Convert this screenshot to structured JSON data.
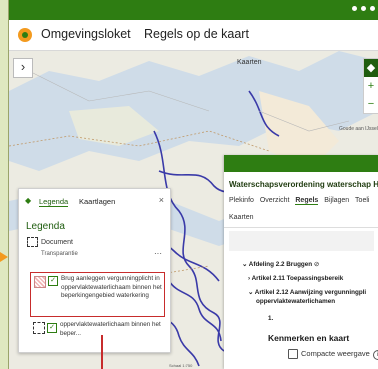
{
  "app": {
    "brand": "Omgevingsloket",
    "nav_link": "Regels op de kaart"
  },
  "map": {
    "labels": {
      "kaarten": "Kaarten",
      "goude": "Goude aan IJssel"
    },
    "scale": "Schaal 1:750",
    "colors": {
      "water": "#cfdce8",
      "land": "#f1efe6",
      "route": "#3a3aa8",
      "accent": "#2e7d12"
    }
  },
  "legend": {
    "tabs": [
      "Legenda",
      "Kaartlagen"
    ],
    "active_tab": "Legenda",
    "title": "Legenda",
    "document_label": "Document",
    "transparency_label": "Transparantie",
    "more": "···",
    "items": [
      {
        "text": "Brug aanleggen vergunningplicht in oppervlaktewaterlichaam binnen het beperkingengebied waterkering",
        "checked": true,
        "highlighted": true
      },
      {
        "text": "oppervlaktewaterlichaam binnen het beper...",
        "checked": true,
        "highlighted": false
      }
    ]
  },
  "panel": {
    "title": "Waterschapsverordening waterschap H",
    "tabs": [
      "Plekinfo",
      "Overzicht",
      "Regels",
      "Bijlagen",
      "Toeli"
    ],
    "active_tab": "Regels",
    "subtab": "Kaarten",
    "tree": [
      "Afdeling 2.2 Bruggen",
      "Artikel 2.11 Toepassingsbereik",
      "Artikel 2.12 Aanwijzing vergunningpli",
      "oppervlaktewaterlichamen",
      "1."
    ],
    "kenmerken_title": "Kenmerken en kaart",
    "compact_label": "Compacte weergave"
  }
}
